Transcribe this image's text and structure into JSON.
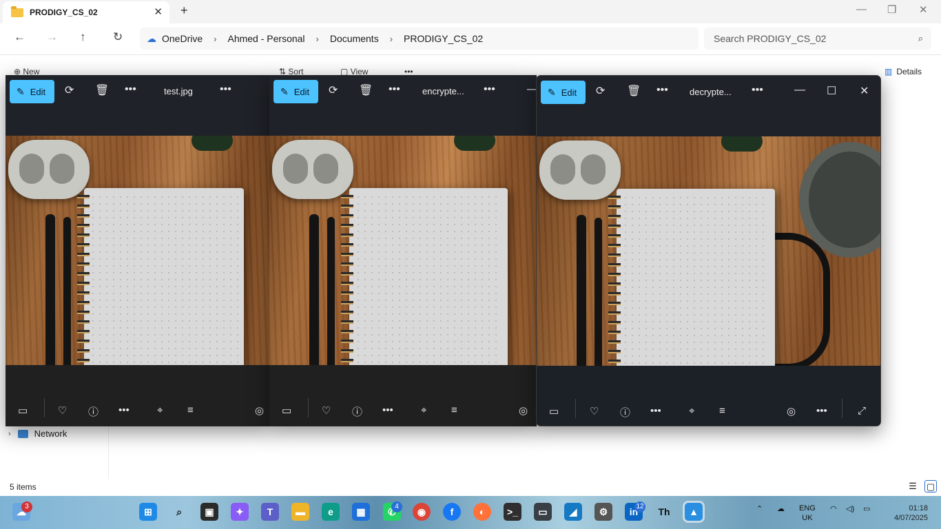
{
  "explorer": {
    "tab_title": "PRODIGY_CS_02",
    "tab_close": "✕",
    "new_tab": "+",
    "window_controls": [
      "—",
      "❐",
      "✕"
    ],
    "nav": {
      "back": "←",
      "forward": "→",
      "up": "↑",
      "refresh": "↻"
    },
    "breadcrumb": [
      "OneDrive",
      "Ahmed - Personal",
      "Documents",
      "PRODIGY_CS_02"
    ],
    "breadcrumb_sep": "›",
    "search_placeholder": "Search PRODIGY_CS_02",
    "commands": {
      "new": "New",
      "sort": "Sort",
      "view": "View",
      "more": "•••",
      "details": "Details"
    },
    "nav_pane": {
      "network": "Network"
    },
    "status": "5 items"
  },
  "viewers": [
    {
      "filename": "test.jpg",
      "edit_label": "Edit"
    },
    {
      "filename": "encrypte...",
      "edit_label": "Edit"
    },
    {
      "filename": "decrypte...",
      "edit_label": "Edit"
    }
  ],
  "viewer_icons": {
    "rotate": "⟳",
    "delete": "🗑",
    "more": "•••",
    "minimize": "—",
    "maximize": "☐",
    "close": "✕",
    "filmstrip": "▭",
    "favorite": "♡",
    "info": "ⓘ",
    "scan": "⌖",
    "text": "≡",
    "ai": "◎",
    "expand": "⤢"
  },
  "taskbar": {
    "weather_badge": "3",
    "whatsapp_badge": "4",
    "linkedin_badge": "12",
    "lang_line1": "ENG",
    "lang_line2": "UK",
    "time": "01:18",
    "date": "4/07/2025"
  },
  "colors": {
    "accent": "#4cc2ff",
    "explorer_bg": "#ffffff",
    "viewer_bg": "#202020"
  }
}
